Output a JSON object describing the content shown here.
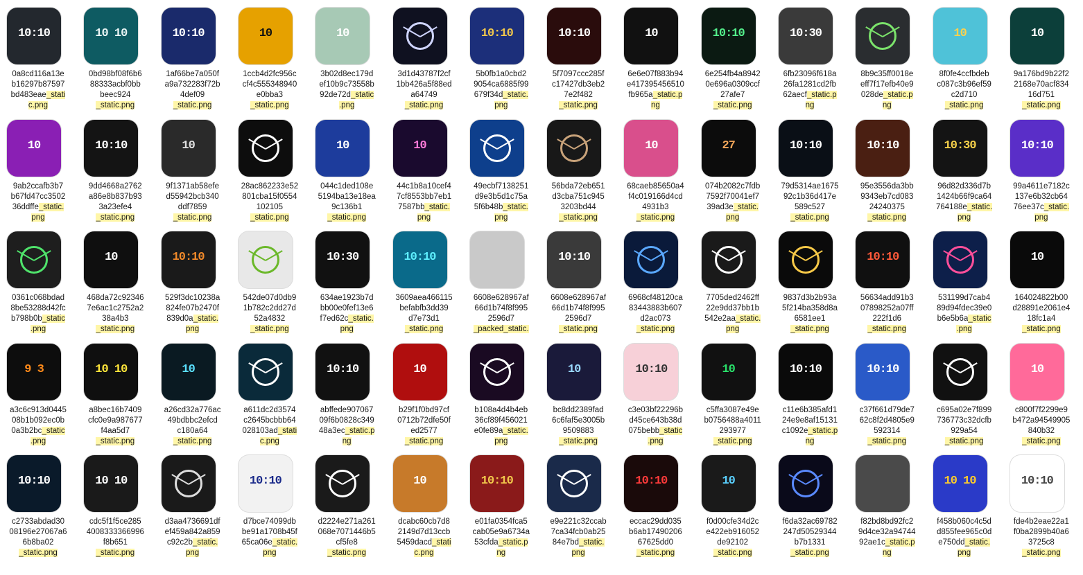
{
  "items": [
    {
      "lines": [
        "0a8cd116a13e",
        "b16297b87597",
        "bd483eae_stati",
        "c.png"
      ],
      "bg": "#23282e",
      "accent": "#ffffff",
      "kind": "digital",
      "time": "10:10"
    },
    {
      "lines": [
        "0bd98bf08f6b6",
        "88333acbf0bb",
        "beec924",
        "_static.png"
      ],
      "bg": "#0e5b62",
      "accent": "#e8f4f4",
      "kind": "digital",
      "time": "10 10"
    },
    {
      "lines": [
        "1af66be7a050f",
        "a9a732283f72b",
        "4def09",
        "_static.png"
      ],
      "bg": "#1a2a6b",
      "accent": "#ffffff",
      "kind": "digital",
      "time": "10:10"
    },
    {
      "lines": [
        "1ccb4d2fc956c",
        "cf4c555348940",
        "e0bba3",
        "_static.png"
      ],
      "bg": "#e6a100",
      "accent": "#111111",
      "kind": "digital",
      "time": "10"
    },
    {
      "lines": [
        "3b02d8ec179d",
        "ef10b9c73558b",
        "92de72d_static",
        ".png"
      ],
      "bg": "#a7c9b5",
      "accent": "#ffffff",
      "kind": "digital",
      "time": "10"
    },
    {
      "lines": [
        "3d1d43787f2cf",
        "1bb426a5f88ed",
        "a64749",
        "_static.png"
      ],
      "bg": "#0f1120",
      "accent": "#cfd5ff",
      "kind": "analog",
      "time": ""
    },
    {
      "lines": [
        "5b0fb1a0cbd2",
        "9054ca6885f99",
        "679f34d_static.",
        "png"
      ],
      "bg": "#1c2f7a",
      "accent": "#f2c84b",
      "kind": "digital",
      "time": "10:10"
    },
    {
      "lines": [
        "5f7097ccc285f",
        "c17427db3eb2",
        "7e2f482",
        "_static.png"
      ],
      "bg": "#2a0c0c",
      "accent": "#ffffff",
      "kind": "digital",
      "time": "10:10"
    },
    {
      "lines": [
        "6e6e07f883b94",
        "e417395456510",
        "fb965a_static.p",
        "ng"
      ],
      "bg": "#111111",
      "accent": "#ffffff",
      "kind": "digital",
      "time": "10"
    },
    {
      "lines": [
        "6e254fb4a8942",
        "0e696a0309ccf",
        "27afe7",
        "_static.png"
      ],
      "bg": "#0b1a12",
      "accent": "#54f08c",
      "kind": "digital",
      "time": "10:10"
    },
    {
      "lines": [
        "6fb23096f618a",
        "26fa1281cd2fb",
        "62aecf_static.p",
        "ng"
      ],
      "bg": "#3a3a3a",
      "accent": "#ffffff",
      "kind": "digital",
      "time": "10:30"
    },
    {
      "lines": [
        "8b9c35ff0018e",
        "eff7f17efb40e9",
        "028de_static.p",
        "ng"
      ],
      "bg": "#2a2d30",
      "accent": "#7be36b",
      "kind": "analog",
      "time": ""
    },
    {
      "lines": [
        "8f0fe4ccfbdeb",
        "c087c3b96ef59",
        "c2d710",
        "_static.png"
      ],
      "bg": "#4fc2d8",
      "accent": "#ffd24d",
      "kind": "digital",
      "time": "10"
    },
    {
      "lines": [
        "9a176bd9b22f2",
        "2168e70acf834",
        "16d751",
        "_static.png"
      ],
      "bg": "#0c3f3a",
      "accent": "#ffffff",
      "kind": "digital",
      "time": "10"
    },
    {
      "lines": [
        "9ab2ccafb3b7",
        "b67fd47cc3502",
        "36ddffe_static.",
        "png"
      ],
      "bg": "#8a1fb4",
      "accent": "#ffffff",
      "kind": "digital",
      "time": "10"
    },
    {
      "lines": [
        "9dd4668a2762",
        "a86e8b837b93",
        "3a23efe4",
        "_static.png"
      ],
      "bg": "#141414",
      "accent": "#ffffff",
      "kind": "digital",
      "time": "10:10"
    },
    {
      "lines": [
        "9f1371ab58efe",
        "d55942bcb340",
        "ddf7859",
        "_static.png"
      ],
      "bg": "#2a2a2a",
      "accent": "#e0e0e0",
      "kind": "digital",
      "time": "10"
    },
    {
      "lines": [
        "28ac862233e52",
        "801cba15f0554",
        "102105",
        "_static.png"
      ],
      "bg": "#0d0d0d",
      "accent": "#ffffff",
      "kind": "analog",
      "time": ""
    },
    {
      "lines": [
        "044c1ded108e",
        "5194ba13e18ea",
        "9c136b1",
        "_static.png"
      ],
      "bg": "#1d3c9c",
      "accent": "#ffffff",
      "kind": "digital",
      "time": "10"
    },
    {
      "lines": [
        "44c1b8a10cef4",
        "7cf8553bb7eb1",
        "7587bb_static.",
        "png"
      ],
      "bg": "#1a0a2e",
      "accent": "#ff7ad9",
      "kind": "digital",
      "time": "10"
    },
    {
      "lines": [
        "49ecbf7138251",
        "d9e3b5d1c75a",
        "5f6b48b_static.",
        "png"
      ],
      "bg": "#0e3f8c",
      "accent": "#ffffff",
      "kind": "analog",
      "time": ""
    },
    {
      "lines": [
        "56bda72eb651",
        "d3cba751c945",
        "3203bd44",
        "_static.png"
      ],
      "bg": "#181818",
      "accent": "#c9a37a",
      "kind": "analog",
      "time": ""
    },
    {
      "lines": [
        "68caeb85650a4",
        "f4c019166d4cd",
        "4931b3",
        "_static.png"
      ],
      "bg": "#d94f8c",
      "accent": "#ffffff",
      "kind": "digital",
      "time": "10"
    },
    {
      "lines": [
        "074b2082c7fdb",
        "7592f70041ef7",
        "39ad3e_static.",
        "png"
      ],
      "bg": "#0c0c0c",
      "accent": "#f2a65a",
      "kind": "digital",
      "time": "27"
    },
    {
      "lines": [
        "79d5314ae1675",
        "92c1b36d417e",
        "589c527",
        "_static.png"
      ],
      "bg": "#0a0f16",
      "accent": "#ffffff",
      "kind": "digital",
      "time": "10:10"
    },
    {
      "lines": [
        "95e3556da3bb",
        "9343eb7cd083",
        "24240375",
        "_static.png"
      ],
      "bg": "#4a1f12",
      "accent": "#ffffff",
      "kind": "digital",
      "time": "10:10"
    },
    {
      "lines": [
        "96d82d336d7b",
        "1424b66f9ca64",
        "764188e_static.",
        "png"
      ],
      "bg": "#141414",
      "accent": "#f7d14a",
      "kind": "digital",
      "time": "10:30"
    },
    {
      "lines": [
        "99a4611e7182c",
        "137e6b32cb64",
        "76ee37c_static.",
        "png"
      ],
      "bg": "#5a2ec8",
      "accent": "#ffffff",
      "kind": "digital",
      "time": "10:10"
    },
    {
      "lines": [
        "0361c068bdad",
        "8be53288d42fc",
        "b798b0b_static",
        ".png"
      ],
      "bg": "#1e1e1e",
      "accent": "#4fe36b",
      "kind": "analog",
      "time": ""
    },
    {
      "lines": [
        "468da72c92346",
        "7e6ac1c2752a2",
        "38a4b3",
        "_static.png"
      ],
      "bg": "#0f0f0f",
      "accent": "#ffffff",
      "kind": "digital",
      "time": "10"
    },
    {
      "lines": [
        "529f3dc10238a",
        "824fe07b2470f",
        "839d0a_static.",
        "png"
      ],
      "bg": "#1a1a1a",
      "accent": "#f28a2a",
      "kind": "digital",
      "time": "10:10"
    },
    {
      "lines": [
        "542de07d0db9",
        "1b782c2dd27d",
        "52a4832",
        "_static.png"
      ],
      "bg": "#e8e8e8",
      "accent": "#6bb82a",
      "kind": "analog",
      "time": ""
    },
    {
      "lines": [
        "634ae1923b7d",
        "bb00e0fef13e6",
        "f7ed62c_static.",
        "png"
      ],
      "bg": "#111111",
      "accent": "#ffffff",
      "kind": "digital",
      "time": "10:30"
    },
    {
      "lines": [
        "3609aea466115",
        "befabfb3dd39",
        "d7e73d1",
        "_static.png"
      ],
      "bg": "#0a6a8a",
      "accent": "#5ff0ff",
      "kind": "digital",
      "time": "10:10"
    },
    {
      "lines": [
        "6608e628967af",
        "66d1b74f8f995",
        "2596d7",
        "_packed_static."
      ],
      "bg": "#c9c9c9",
      "accent": "#333333",
      "kind": "digital",
      "time": ""
    },
    {
      "lines": [
        "6608e628967af",
        "66d1b74f8f995",
        "2596d7",
        "_static.png"
      ],
      "bg": "#3a3a3a",
      "accent": "#ffffff",
      "kind": "digital",
      "time": "10:10"
    },
    {
      "lines": [
        "6968cf48120ca",
        "83443883b607",
        "d2ac073",
        "_static.png"
      ],
      "bg": "#0a1a3a",
      "accent": "#5aa8ff",
      "kind": "analog",
      "time": ""
    },
    {
      "lines": [
        "7705ded2462ff",
        "22e9dd37bb1b",
        "542e2aa_static.",
        "png"
      ],
      "bg": "#1a1a1a",
      "accent": "#ffffff",
      "kind": "analog",
      "time": ""
    },
    {
      "lines": [
        "9837d3b2b93a",
        "5f214ba358d8a",
        "6581ee1",
        "_static.png"
      ],
      "bg": "#0a0a0a",
      "accent": "#f7c948",
      "kind": "analog",
      "time": ""
    },
    {
      "lines": [
        "56634add91b3",
        "07898252a07ff",
        "222f1d6",
        "_static.png"
      ],
      "bg": "#101010",
      "accent": "#ff5a3a",
      "kind": "digital",
      "time": "10:10"
    },
    {
      "lines": [
        "531199d7cab4",
        "89d94fdec39e0",
        "b6e5b6a_static",
        ".png"
      ],
      "bg": "#0d1f4a",
      "accent": "#ff4f9a",
      "kind": "analog",
      "time": ""
    },
    {
      "lines": [
        "164024822b00",
        "d28891e2061e4",
        "18fc1a4",
        "_static.png"
      ],
      "bg": "#0a0a0a",
      "accent": "#ffffff",
      "kind": "digital",
      "time": "10"
    },
    {
      "lines": [
        "a3c6c913d0445",
        "08b1b092ec0b",
        "0a3b2bc_static",
        ".png"
      ],
      "bg": "#0d0d0d",
      "accent": "#ff8a1a",
      "kind": "digital",
      "time": "9 3"
    },
    {
      "lines": [
        "a8bec16b7409",
        "cfc0e9a987677",
        "f4aa5d7",
        "_static.png"
      ],
      "bg": "#0f0f0f",
      "accent": "#ffe53a",
      "kind": "digital",
      "time": "10 10"
    },
    {
      "lines": [
        "a26cd32a776ac",
        "49bdbbc2efcd",
        "c180a64",
        "_static.png"
      ],
      "bg": "#0a1a22",
      "accent": "#5ae0ff",
      "kind": "digital",
      "time": "10"
    },
    {
      "lines": [
        "a611dc2d3574",
        "c2645bcbbb64",
        "028103ad_stati",
        "c.png"
      ],
      "bg": "#0a2a3a",
      "accent": "#ffffff",
      "kind": "analog",
      "time": ""
    },
    {
      "lines": [
        "abffede907067",
        "09f6b0828c349",
        "48a3ec_static.p",
        "ng"
      ],
      "bg": "#111111",
      "accent": "#ffffff",
      "kind": "digital",
      "time": "10:10"
    },
    {
      "lines": [
        "b29f1f0bd97cf",
        "0712b72dfe50f",
        "ed2577",
        "_static.png"
      ],
      "bg": "#b00e0e",
      "accent": "#ffffff",
      "kind": "digital",
      "time": "10"
    },
    {
      "lines": [
        "b108a4d4b4eb",
        "36cf89f456021",
        "e0fe89a_static.",
        "png"
      ],
      "bg": "#1a0a22",
      "accent": "#ffffff",
      "kind": "analog",
      "time": ""
    },
    {
      "lines": [
        "bc8dd2389fad",
        "6c6faf5e3005b",
        "9509883",
        "_static.png"
      ],
      "bg": "#1a1a3a",
      "accent": "#9ad8ff",
      "kind": "digital",
      "time": "10"
    },
    {
      "lines": [
        "c3e03bf22296b",
        "d45ce643b38d",
        "075bebb_static",
        ".png"
      ],
      "bg": "#f7d0d8",
      "accent": "#333333",
      "kind": "digital",
      "time": "10:10"
    },
    {
      "lines": [
        "c5ffa3087e49e",
        "b0756488a4011",
        "293977",
        "_static.png"
      ],
      "bg": "#111111",
      "accent": "#29e06a",
      "kind": "digital",
      "time": "10"
    },
    {
      "lines": [
        "c11e6b385afd1",
        "24e9e8af15131",
        "c1092e_static.p",
        "ng"
      ],
      "bg": "#0a0a0a",
      "accent": "#ffffff",
      "kind": "digital",
      "time": "10:10"
    },
    {
      "lines": [
        "c37f661d79de7",
        "62c8f2d4805e9",
        "592314",
        "_static.png"
      ],
      "bg": "#2a5ac8",
      "accent": "#ffffff",
      "kind": "digital",
      "time": "10:10"
    },
    {
      "lines": [
        "c695a02e7f899",
        "736773c32dcfb",
        "929a54",
        "_static.png"
      ],
      "bg": "#111111",
      "accent": "#ffffff",
      "kind": "analog",
      "time": ""
    },
    {
      "lines": [
        "c800f7f2299e9",
        "b472a94549905",
        "840b32",
        "_static.png"
      ],
      "bg": "#ff6a9a",
      "accent": "#ffffff",
      "kind": "digital",
      "time": "10"
    },
    {
      "lines": [
        "c2733abdad30",
        "08196e27067a6",
        "6b8ba02",
        "_static.png"
      ],
      "bg": "#0a1a2a",
      "accent": "#ffffff",
      "kind": "digital",
      "time": "10:10"
    },
    {
      "lines": [
        "cdc5f1f5ce285",
        "4008333366996",
        "f8b651",
        "_static.png"
      ],
      "bg": "#1a1a1a",
      "accent": "#ffffff",
      "kind": "digital",
      "time": "10 10"
    },
    {
      "lines": [
        "d3aa4736691df",
        "ef459a842a859",
        "c92c2b_static.",
        "png"
      ],
      "bg": "#1a1a1a",
      "accent": "#dddddd",
      "kind": "analog",
      "time": ""
    },
    {
      "lines": [
        "d7bce74099db",
        "be91a1708b45f",
        "65ca06e_static.",
        "png"
      ],
      "bg": "#f2f2f2",
      "accent": "#1a2a8a",
      "kind": "digital",
      "time": "10:10"
    },
    {
      "lines": [
        "d2224e271a261",
        "068e7071446b5",
        "cf5fe8",
        "_static.png"
      ],
      "bg": "#1a1a1a",
      "accent": "#ffffff",
      "kind": "analog",
      "time": ""
    },
    {
      "lines": [
        "dcabc60cb7d8",
        "2149d7d13ccb",
        "5459dacd_stati",
        "c.png"
      ],
      "bg": "#c77a2a",
      "accent": "#ffffff",
      "kind": "digital",
      "time": "10"
    },
    {
      "lines": [
        "e01fa0354fca5",
        "cab05e9a6734a",
        "53cfda_static.p",
        "ng"
      ],
      "bg": "#8a1a1a",
      "accent": "#f2c84b",
      "kind": "digital",
      "time": "10:10"
    },
    {
      "lines": [
        "e9e221c32ccab",
        "7ca34fcb0ab25",
        "84e7bd_static.",
        "png"
      ],
      "bg": "#1a2a4a",
      "accent": "#ffffff",
      "kind": "analog",
      "time": ""
    },
    {
      "lines": [
        "eccac29dd035",
        "b6ab17490206",
        "67625dd0",
        "_static.png"
      ],
      "bg": "#1a0a0a",
      "accent": "#ff3a3a",
      "kind": "digital",
      "time": "10:10"
    },
    {
      "lines": [
        "f0d00cfe34d2c",
        "e422eb916052",
        "de92102",
        "_static.png"
      ],
      "bg": "#1a1a1a",
      "accent": "#5ad0ff",
      "kind": "digital",
      "time": "10"
    },
    {
      "lines": [
        "f6da32ac69782",
        "247d50529344",
        "b7b1331",
        "_static.png"
      ],
      "bg": "#0a0a1a",
      "accent": "#5a8aff",
      "kind": "analog",
      "time": ""
    },
    {
      "lines": [
        "f82bd8bd92fc2",
        "9d4ce32a94744",
        "92ae1c_static.p",
        "ng"
      ],
      "bg": "#4a4a4a",
      "accent": "#ffffff",
      "kind": "digital",
      "time": ""
    },
    {
      "lines": [
        "f458b060c4c5d",
        "d855fee965c0d",
        "e750dd_static.",
        "png"
      ],
      "bg": "#2a3ac8",
      "accent": "#ffcc2a",
      "kind": "digital",
      "time": "10 10"
    },
    {
      "lines": [
        "fde4b2eae22a1",
        "f0ba2899b40a6",
        "3725c8",
        "_static.png"
      ],
      "bg": "#ffffff",
      "accent": "#444444",
      "kind": "digital",
      "time": "10:10"
    }
  ]
}
